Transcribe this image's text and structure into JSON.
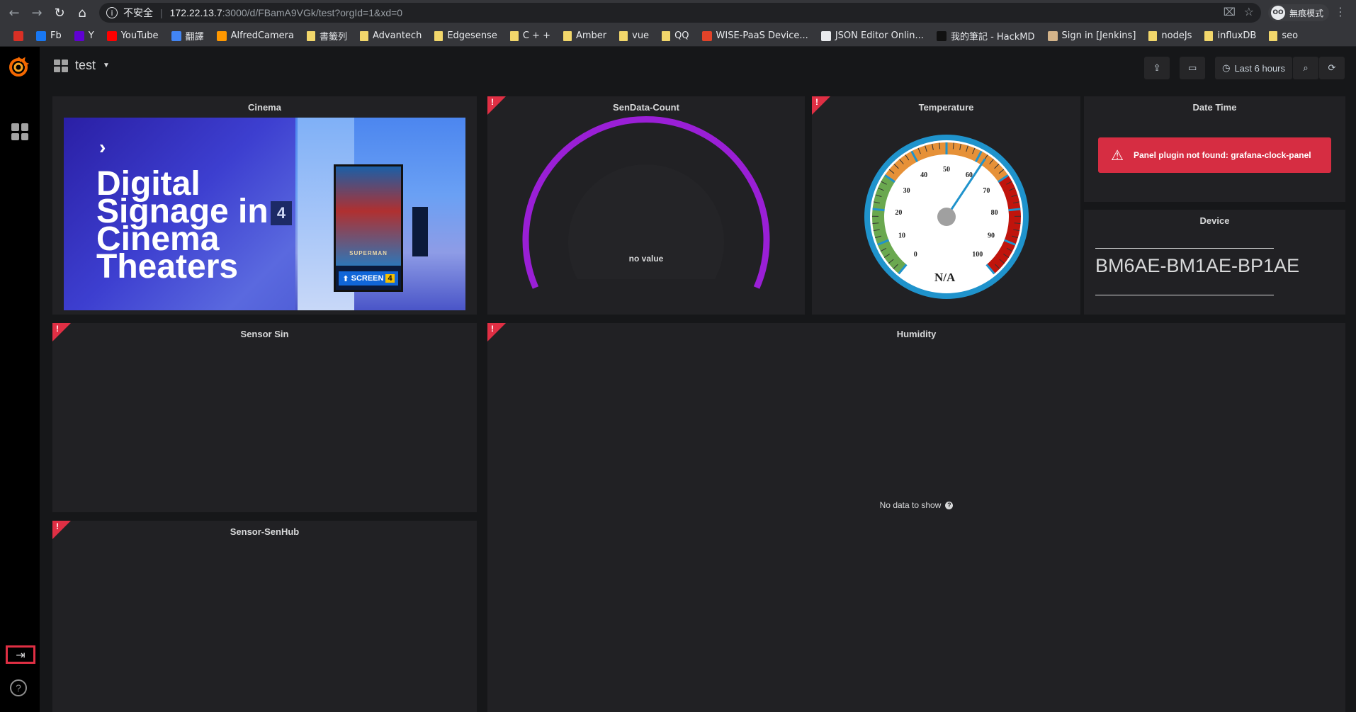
{
  "browser": {
    "security_label": "不安全",
    "url_host": "172.22.13.7",
    "url_path": ":3000/d/FBamA9VGk/test?orgId=1&xd=0",
    "profile_label": "無痕模式",
    "profile_initials": "OO",
    "bookmarks": [
      {
        "label": "",
        "icon": "gmail-icon",
        "color": "#d93025"
      },
      {
        "label": "Fb",
        "icon": "facebook-icon",
        "color": "#1877f2"
      },
      {
        "label": "Y",
        "icon": "yahoo-icon",
        "color": "#6001d2"
      },
      {
        "label": "YouTube",
        "icon": "youtube-icon",
        "color": "#ff0000"
      },
      {
        "label": "翻譯",
        "icon": "translate-icon",
        "color": "#4285f4"
      },
      {
        "label": "AlfredCamera",
        "icon": "alfred-icon",
        "color": "#ff9800"
      },
      {
        "label": "書籤列",
        "icon": "folder-icon",
        "color": "#f2d76b"
      },
      {
        "label": "Advantech",
        "icon": "folder-icon",
        "color": "#f2d76b"
      },
      {
        "label": "Edgesense",
        "icon": "folder-icon",
        "color": "#f2d76b"
      },
      {
        "label": "C + +",
        "icon": "folder-icon",
        "color": "#f2d76b"
      },
      {
        "label": "Amber",
        "icon": "folder-icon",
        "color": "#f2d76b"
      },
      {
        "label": "vue",
        "icon": "folder-icon",
        "color": "#f2d76b"
      },
      {
        "label": "QQ",
        "icon": "folder-icon",
        "color": "#f2d76b"
      },
      {
        "label": "WISE-PaaS Device...",
        "icon": "gitlab-icon",
        "color": "#e24329"
      },
      {
        "label": "JSON Editor Onlin...",
        "icon": "json-icon",
        "color": "#e8eaed"
      },
      {
        "label": "我的筆記 - HackMD",
        "icon": "hackmd-icon",
        "color": "#111111"
      },
      {
        "label": "Sign in [Jenkins]",
        "icon": "jenkins-icon",
        "color": "#d4b48a"
      },
      {
        "label": "nodeJs",
        "icon": "folder-icon",
        "color": "#f2d76b"
      },
      {
        "label": "influxDB",
        "icon": "folder-icon",
        "color": "#f2d76b"
      },
      {
        "label": "seo",
        "icon": "folder-icon",
        "color": "#f2d76b"
      }
    ]
  },
  "dashboard": {
    "title": "test",
    "time_range": "Last 6 hours"
  },
  "panels": {
    "cinema": {
      "title": "Cinema",
      "image_text": [
        "Digital",
        "Signage in",
        "Cinema",
        "Theaters"
      ],
      "poster_title": "SUPERMAN",
      "poster_screen": "SCREEN",
      "poster_screen_num": "4",
      "wall_number": "4"
    },
    "sendata_count": {
      "title": "SenData-Count",
      "value_text": "no value",
      "arc_color": "#9a1fd6"
    },
    "temperature": {
      "title": "Temperature",
      "value_text": "N/A",
      "ticks": [
        "0",
        "10",
        "20",
        "30",
        "40",
        "50",
        "60",
        "70",
        "80",
        "90",
        "100"
      ],
      "needle_value": 62
    },
    "date_time": {
      "title": "Date Time",
      "error": "Panel plugin not found: grafana-clock-panel"
    },
    "device": {
      "title": "Device",
      "value": "BM6AE-BM1AE-BP1AE"
    },
    "sensor_sin": {
      "title": "Sensor Sin"
    },
    "humidity": {
      "title": "Humidity",
      "nodata": "No data to show"
    },
    "sensor_senhub": {
      "title": "Sensor-SenHub"
    }
  },
  "colors": {
    "grafana_bg": "#161719",
    "panel_bg": "#212124",
    "error_red": "#e02f44",
    "gauge_rim": "#1f93cc"
  }
}
